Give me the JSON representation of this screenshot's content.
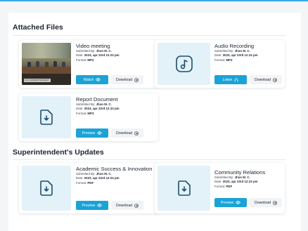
{
  "sections": {
    "attached_files": {
      "title": "Attached Files"
    },
    "superintendent": {
      "title": "Superintendent's Updates"
    }
  },
  "cards": {
    "video": {
      "title": "Video meeting",
      "submitted_prefix": "Submitted By:",
      "submitted_by": "Jhon M. C.",
      "date_prefix": "Date:",
      "date": "2023, apr 23rd 12:23 pm",
      "format_prefix": "Format:",
      "format": "MP3",
      "primary_label": "Watch",
      "secondary_label": "Download",
      "thumb_caption": "CCS SUPERINTENDENT"
    },
    "audio": {
      "title": "Audio Recording",
      "submitted_prefix": "Submitted By:",
      "submitted_by": "Jhon M. C.",
      "date_prefix": "Date:",
      "date": "2023, apr 23rd 12:23 pm",
      "format_prefix": "Format:",
      "format": "MP3",
      "primary_label": "Listen",
      "secondary_label": "Download"
    },
    "report": {
      "title": "Report Document",
      "submitted_prefix": "Submitted By:",
      "submitted_by": "Jhon M. C.",
      "date_prefix": "Date:",
      "date": "2023, apr 23rd 12:23 pm",
      "format_prefix": "Format:",
      "format": "MP3",
      "primary_label": "Preview",
      "secondary_label": "Download"
    },
    "academic": {
      "title": "Academic Success & Innovation",
      "submitted_prefix": "Submitted By:",
      "submitted_by": "Jhon M. C.",
      "date_prefix": "Date:",
      "date": "2023, apr 23rd 12:23 pm",
      "format_prefix": "Format:",
      "format": "PDF",
      "primary_label": "Preview",
      "secondary_label": "Download"
    },
    "community": {
      "title": "Community Relations",
      "submitted_prefix": "Submitted By:",
      "submitted_by": "Jhon M. C.",
      "date_prefix": "Date:",
      "date": "2023, apr 23rd 12:23 pm",
      "format_prefix": "Format:",
      "format": "PDF",
      "primary_label": "Preview",
      "secondary_label": "Download"
    }
  },
  "colors": {
    "accent": "#1aa3d6",
    "thumb_bg": "#e3f2f8",
    "top_bar": "#3aa9e6"
  }
}
